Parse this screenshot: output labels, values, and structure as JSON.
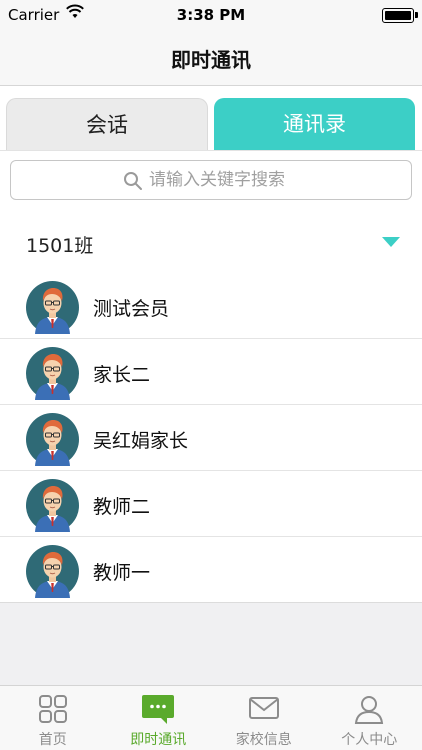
{
  "status_bar": {
    "carrier": "Carrier",
    "time": "3:38 PM"
  },
  "nav": {
    "title": "即时通讯"
  },
  "segments": {
    "conversations": "会话",
    "contacts": "通讯录",
    "active": "contacts"
  },
  "search": {
    "placeholder": "请输入关键字搜索",
    "value": ""
  },
  "group": {
    "title": "1501班",
    "expanded": true
  },
  "contacts": [
    {
      "name": "测试会员"
    },
    {
      "name": "家长二"
    },
    {
      "name": "吴红娟家长"
    },
    {
      "name": "教师二"
    },
    {
      "name": "教师一"
    }
  ],
  "tabs": [
    {
      "label": "首页",
      "icon": "grid-icon"
    },
    {
      "label": "即时通讯",
      "icon": "chat-bubble-icon"
    },
    {
      "label": "家校信息",
      "icon": "envelope-icon"
    },
    {
      "label": "个人中心",
      "icon": "person-icon"
    }
  ],
  "active_tab": 1,
  "colors": {
    "accent_teal": "#3ccfc6",
    "tab_active_green": "#5aaa2c",
    "avatar_bg": "#2f6a76"
  }
}
